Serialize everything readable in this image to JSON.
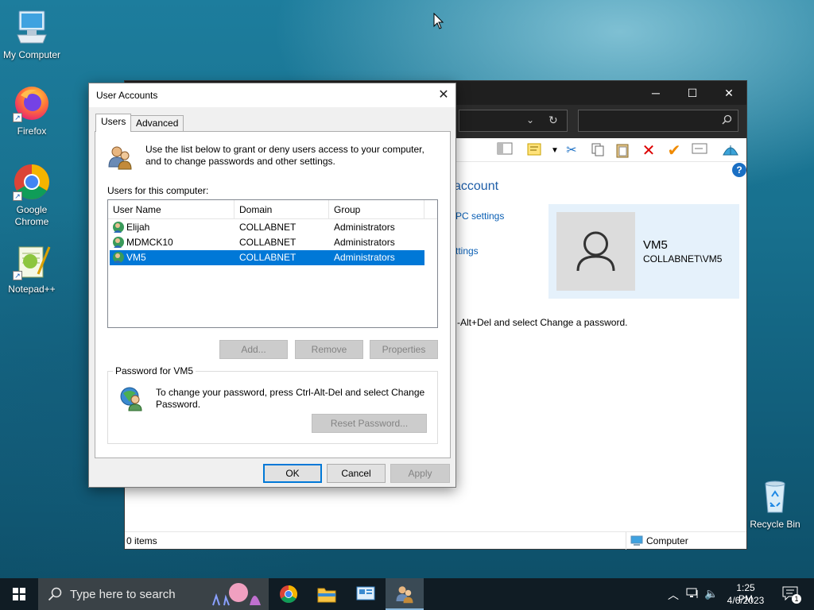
{
  "desktop": {
    "icons": [
      {
        "label": "My Computer"
      },
      {
        "label": "Firefox"
      },
      {
        "label": "Google Chrome"
      },
      {
        "label": "Notepad++"
      },
      {
        "label": "Recycle Bin"
      }
    ]
  },
  "explorer": {
    "heading_partial": "account",
    "link_pc_settings": "PC settings",
    "link_settings": "ttings",
    "user_name": "VM5",
    "user_fullname": "COLLABNET\\VM5",
    "password_hint_partial": "-Alt+Del and select Change a password.",
    "status_items": "0 items",
    "status_computer": "Computer"
  },
  "dialog": {
    "title": "User Accounts",
    "tabs": [
      {
        "label": "Users",
        "active": true
      },
      {
        "label": "Advanced",
        "active": false
      }
    ],
    "intro_text": "Use the list below to grant or deny users access to your computer, and to change passwords and other settings.",
    "users_label": "Users for this computer:",
    "columns": [
      "User Name",
      "Domain",
      "Group"
    ],
    "rows": [
      {
        "name": "Elijah",
        "domain": "COLLABNET",
        "group": "Administrators",
        "selected": false
      },
      {
        "name": "MDMCK10",
        "domain": "COLLABNET",
        "group": "Administrators",
        "selected": false
      },
      {
        "name": "VM5",
        "domain": "COLLABNET",
        "group": "Administrators",
        "selected": true
      }
    ],
    "buttons": {
      "add": "Add...",
      "remove": "Remove",
      "properties": "Properties",
      "reset_password": "Reset Password...",
      "ok": "OK",
      "cancel": "Cancel",
      "apply": "Apply"
    },
    "password_group_label": "Password for VM5",
    "password_text": "To change your password, press Ctrl-Alt-Del and select Change Password."
  },
  "taskbar": {
    "search_placeholder": "Type here to search",
    "time": "1:25 PM",
    "date": "4/6/2023",
    "notification_count": "1"
  },
  "colors": {
    "selection": "#0078d7",
    "link": "#0a5fb4",
    "taskbar": "#101c24"
  }
}
